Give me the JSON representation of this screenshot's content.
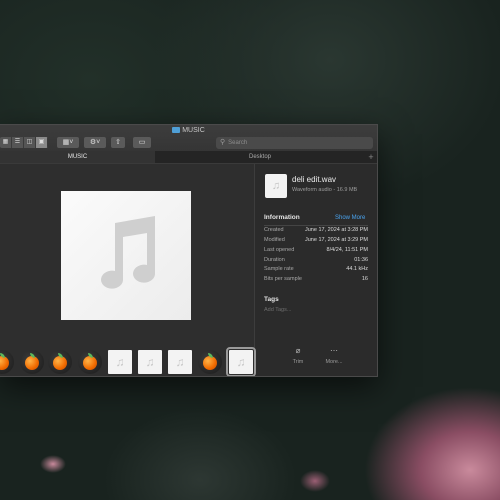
{
  "window": {
    "title": "MUSIC",
    "search_placeholder": "Search",
    "tabs": [
      {
        "label": "MUSIC",
        "active": true
      },
      {
        "label": "Desktop",
        "active": false
      }
    ],
    "tab_add": "+"
  },
  "toolbar": {
    "view_icons": [
      "icon-view-icon",
      "list-view-icon",
      "column-view-icon",
      "gallery-view-icon"
    ],
    "group_icon": "group-by-icon",
    "action_icon": "gear-icon",
    "share_icon": "share-icon",
    "tag_icon": "tag-icon"
  },
  "strip": {
    "items": [
      {
        "kind": "fl-studio-project",
        "icon": "fl-studio-icon"
      },
      {
        "kind": "fl-studio-project",
        "icon": "fl-studio-icon"
      },
      {
        "kind": "fl-studio-project",
        "icon": "fl-studio-icon"
      },
      {
        "kind": "fl-studio-project",
        "icon": "fl-studio-icon"
      },
      {
        "kind": "audio-file",
        "icon": "music-note-icon"
      },
      {
        "kind": "audio-file",
        "icon": "music-note-icon"
      },
      {
        "kind": "audio-file",
        "icon": "music-note-icon"
      },
      {
        "kind": "fl-studio-project",
        "icon": "fl-studio-icon"
      },
      {
        "kind": "audio-file",
        "icon": "music-note-icon",
        "selected": true
      }
    ]
  },
  "inspector": {
    "filename": "deli edit.wav",
    "kind": "Waveform audio - 16.9 MB",
    "info_heading": "Information",
    "show_more": "Show More",
    "rows": [
      {
        "label": "Created",
        "value": "June 17, 2024 at 3:28 PM"
      },
      {
        "label": "Modified",
        "value": "June 17, 2024 at 3:29 PM"
      },
      {
        "label": "Last opened",
        "value": "8/4/24, 11:51 PM"
      },
      {
        "label": "Duration",
        "value": "01:36"
      },
      {
        "label": "Sample rate",
        "value": "44.1 kHz"
      },
      {
        "label": "Bits per sample",
        "value": "16"
      }
    ],
    "tags_heading": "Tags",
    "tags_placeholder": "Add Tags...",
    "actions": [
      {
        "label": "Trim",
        "icon": "trim-icon"
      },
      {
        "label": "More...",
        "icon": "more-icon"
      }
    ]
  },
  "colors": {
    "accent": "#4aa4f0",
    "window_bg": "#2a2a2a",
    "folder": "#4f9fd6"
  }
}
